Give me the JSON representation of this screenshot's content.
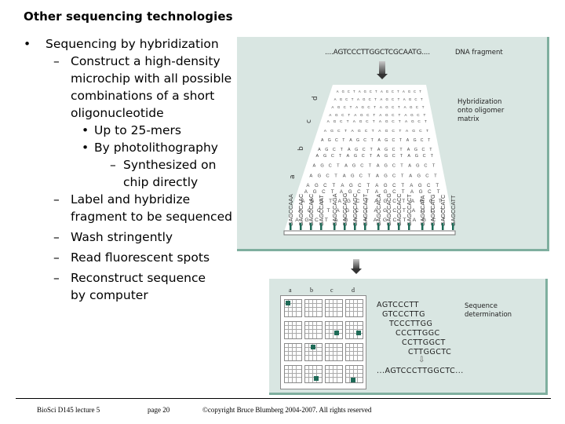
{
  "title": "Other sequencing technologies",
  "bullets": {
    "l1": "Sequencing by hybridization",
    "l2a": "Construct a high-density",
    "l2b": "microchip with all possible",
    "l2c": "combinations of a short",
    "l2d": "oligonucleotide",
    "l3a": "Up to 25-mers",
    "l3b": "By photolithography",
    "l4a": "Synthesized on",
    "l4b": "chip directly",
    "l5a": "Label and hybridize",
    "l5b": "fragment to be sequenced",
    "l6": "Wash stringently",
    "l7": "Read fluorescent spots",
    "l8a": "Reconstruct sequence",
    "l8b": "by computer",
    "bullet_glyph": "•",
    "dash_glyph": "–"
  },
  "figure1": {
    "fragment": "....AGTCCCTTGGCTCGCAATG....",
    "fragment_label": "DNA fragment",
    "hyb_label_1": "Hybridization",
    "hyb_label_2": "onto oligomer",
    "hyb_label_3": "matrix",
    "row_labels": [
      "a",
      "b",
      "c",
      "d"
    ],
    "probes": [
      "GAGCCAAA",
      "GAGCCAAC",
      "GAGCCAAC",
      "GAGCCAAT",
      "GAGCCAGA",
      "GAGCCAGG",
      "GAGCCAGC",
      "GAGCCAGT",
      "GAGCCACA",
      "GAGCCACG",
      "GAGCCACC",
      "GAGCCACT",
      "GAGCCATA",
      "GAGCCATG",
      "GAGCCATC",
      "GAGCCATT"
    ]
  },
  "figure2": {
    "col_labels": [
      "a",
      "b",
      "c",
      "d"
    ],
    "seq_lines": [
      "AGTCCCTT",
      "GTCCCTTG",
      "TCCCTTGG",
      "CCCTTGGC",
      "CCTTGGCT",
      "CTTGGCTC"
    ],
    "down_glyph": "⇩",
    "result": "...AGTCCCTTGGCTC...",
    "label_1": "Sequence",
    "label_2": "determination"
  },
  "footer": {
    "course": "BioSci D145 lecture 5",
    "page": "page 20",
    "copyright": "©copyright Bruce Blumberg 2004-2007. All rights reserved"
  },
  "colors": {
    "panel": "#d9e6e2",
    "panel_border": "#7faf9f",
    "spot": "#1f6b58"
  }
}
